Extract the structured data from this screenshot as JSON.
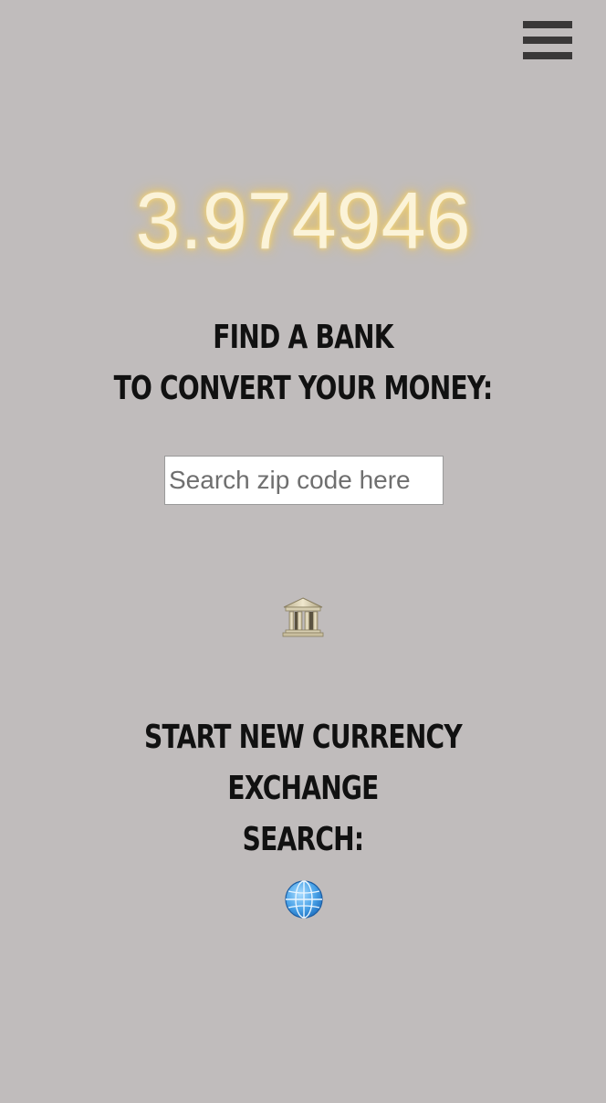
{
  "header": {
    "menu_icon": "hamburger-menu-icon"
  },
  "rate": {
    "value": "3.974946"
  },
  "find_bank": {
    "line1": "FIND A BANK",
    "line2": "TO CONVERT YOUR MONEY:",
    "search": {
      "placeholder": "Search zip code here",
      "value": ""
    },
    "icon": "bank-building-icon"
  },
  "new_search": {
    "line1": "START NEW CURRENCY EXCHANGE",
    "line2": "SEARCH:",
    "icon": "globe-icon"
  },
  "colors": {
    "background": "#c0bcbc",
    "rate_text": "#fbf3d8",
    "rate_glow": "#e9c76a",
    "menu": "#3a3838"
  }
}
